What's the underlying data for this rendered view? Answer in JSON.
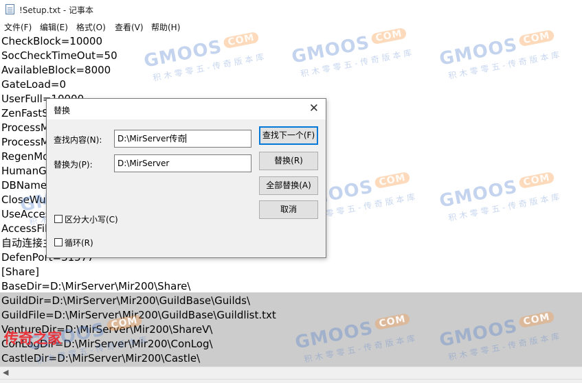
{
  "window": {
    "title": "!Setup.txt - 记事本"
  },
  "menu": [
    "文件(F)",
    "编辑(E)",
    "格式(O)",
    "查看(V)",
    "帮助(H)"
  ],
  "lines": [
    "CheckBlock=10000",
    "SocCheckTimeOut=50",
    "AvailableBlock=8000",
    "GateLoad=0",
    "UserFull=10000",
    "ZenFastS",
    "ProcessM",
    "ProcessM",
    "RegenMo",
    "HumanG",
    "DBName",
    "CloseWu",
    "UseAcces",
    "AccessFil",
    "自动连接主",
    "DefenPort=31577",
    "[Share]",
    "BaseDir=D:\\MirServer\\Mir200\\Share\\",
    "GuildDir=D:\\MirServer\\Mir200\\GuildBase\\Guilds\\",
    "GuildFile=D:\\MirServer\\Mir200\\GuildBase\\Guildlist.txt",
    "VentureDir=D:\\MirServer\\Mir200\\ShareV\\",
    "ConLogDir=D:\\MirServer\\Mir200\\ConLog\\",
    "CastleDir=D:\\MirServer\\Mir200\\Castle\\"
  ],
  "dialog": {
    "title": "替换",
    "find_label": "查找内容(N):",
    "find_value": "D:\\MirServer传奇",
    "replace_label": "替换为(P):",
    "replace_value": "D:\\MirServer",
    "btn_find_next": "查找下一个(F)",
    "btn_replace": "替换(R)",
    "btn_replace_all": "全部替换(A)",
    "btn_cancel": "取消",
    "match_case_label": "区分大小写(C)",
    "wrap_label": "循环(R)",
    "match_case_checked": false,
    "wrap_checked": false
  },
  "watermark": {
    "logo": "GMOOS",
    "com": "COM",
    "sub": "积木零零五-传奇版本库"
  },
  "overlay_text": "传奇之家",
  "colors": {
    "dialog_default_border": "#0078d7",
    "selection": "#cccccc",
    "overlay_red": "#e8333a"
  }
}
